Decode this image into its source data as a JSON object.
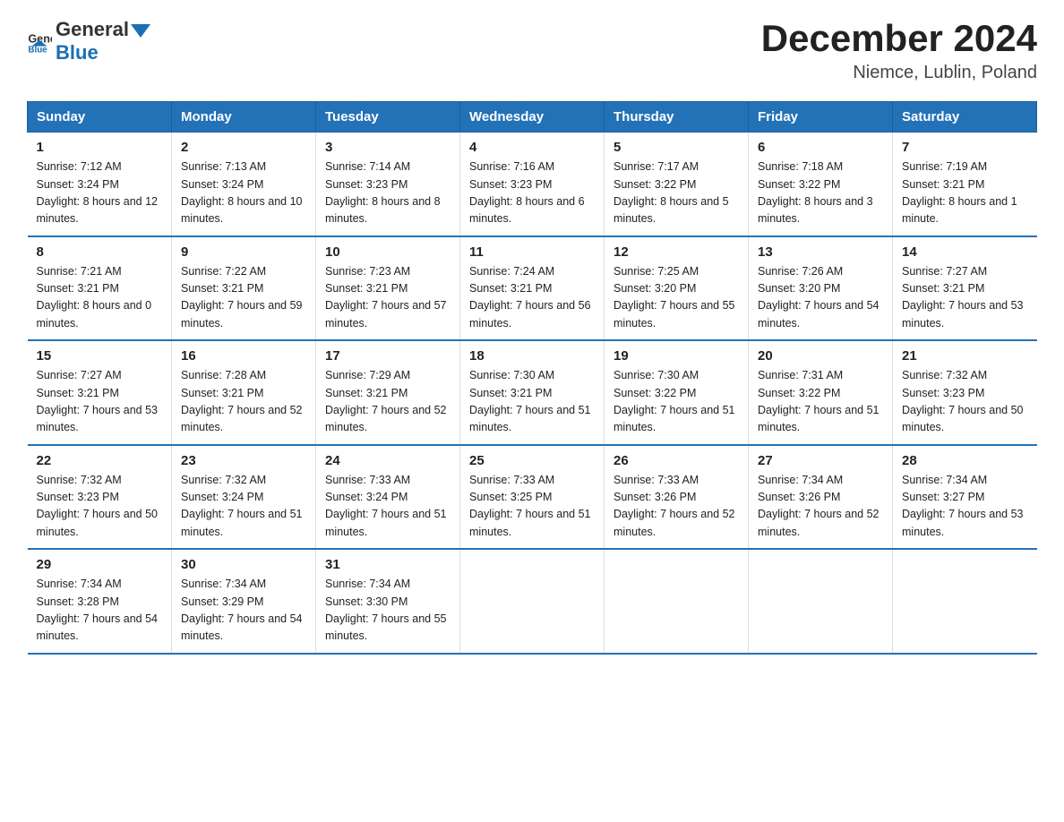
{
  "header": {
    "logo_general": "General",
    "logo_blue": "Blue",
    "month_year": "December 2024",
    "location": "Niemce, Lublin, Poland"
  },
  "days_of_week": [
    "Sunday",
    "Monday",
    "Tuesday",
    "Wednesday",
    "Thursday",
    "Friday",
    "Saturday"
  ],
  "weeks": [
    [
      {
        "num": "1",
        "sunrise": "Sunrise: 7:12 AM",
        "sunset": "Sunset: 3:24 PM",
        "daylight": "Daylight: 8 hours and 12 minutes."
      },
      {
        "num": "2",
        "sunrise": "Sunrise: 7:13 AM",
        "sunset": "Sunset: 3:24 PM",
        "daylight": "Daylight: 8 hours and 10 minutes."
      },
      {
        "num": "3",
        "sunrise": "Sunrise: 7:14 AM",
        "sunset": "Sunset: 3:23 PM",
        "daylight": "Daylight: 8 hours and 8 minutes."
      },
      {
        "num": "4",
        "sunrise": "Sunrise: 7:16 AM",
        "sunset": "Sunset: 3:23 PM",
        "daylight": "Daylight: 8 hours and 6 minutes."
      },
      {
        "num": "5",
        "sunrise": "Sunrise: 7:17 AM",
        "sunset": "Sunset: 3:22 PM",
        "daylight": "Daylight: 8 hours and 5 minutes."
      },
      {
        "num": "6",
        "sunrise": "Sunrise: 7:18 AM",
        "sunset": "Sunset: 3:22 PM",
        "daylight": "Daylight: 8 hours and 3 minutes."
      },
      {
        "num": "7",
        "sunrise": "Sunrise: 7:19 AM",
        "sunset": "Sunset: 3:21 PM",
        "daylight": "Daylight: 8 hours and 1 minute."
      }
    ],
    [
      {
        "num": "8",
        "sunrise": "Sunrise: 7:21 AM",
        "sunset": "Sunset: 3:21 PM",
        "daylight": "Daylight: 8 hours and 0 minutes."
      },
      {
        "num": "9",
        "sunrise": "Sunrise: 7:22 AM",
        "sunset": "Sunset: 3:21 PM",
        "daylight": "Daylight: 7 hours and 59 minutes."
      },
      {
        "num": "10",
        "sunrise": "Sunrise: 7:23 AM",
        "sunset": "Sunset: 3:21 PM",
        "daylight": "Daylight: 7 hours and 57 minutes."
      },
      {
        "num": "11",
        "sunrise": "Sunrise: 7:24 AM",
        "sunset": "Sunset: 3:21 PM",
        "daylight": "Daylight: 7 hours and 56 minutes."
      },
      {
        "num": "12",
        "sunrise": "Sunrise: 7:25 AM",
        "sunset": "Sunset: 3:20 PM",
        "daylight": "Daylight: 7 hours and 55 minutes."
      },
      {
        "num": "13",
        "sunrise": "Sunrise: 7:26 AM",
        "sunset": "Sunset: 3:20 PM",
        "daylight": "Daylight: 7 hours and 54 minutes."
      },
      {
        "num": "14",
        "sunrise": "Sunrise: 7:27 AM",
        "sunset": "Sunset: 3:21 PM",
        "daylight": "Daylight: 7 hours and 53 minutes."
      }
    ],
    [
      {
        "num": "15",
        "sunrise": "Sunrise: 7:27 AM",
        "sunset": "Sunset: 3:21 PM",
        "daylight": "Daylight: 7 hours and 53 minutes."
      },
      {
        "num": "16",
        "sunrise": "Sunrise: 7:28 AM",
        "sunset": "Sunset: 3:21 PM",
        "daylight": "Daylight: 7 hours and 52 minutes."
      },
      {
        "num": "17",
        "sunrise": "Sunrise: 7:29 AM",
        "sunset": "Sunset: 3:21 PM",
        "daylight": "Daylight: 7 hours and 52 minutes."
      },
      {
        "num": "18",
        "sunrise": "Sunrise: 7:30 AM",
        "sunset": "Sunset: 3:21 PM",
        "daylight": "Daylight: 7 hours and 51 minutes."
      },
      {
        "num": "19",
        "sunrise": "Sunrise: 7:30 AM",
        "sunset": "Sunset: 3:22 PM",
        "daylight": "Daylight: 7 hours and 51 minutes."
      },
      {
        "num": "20",
        "sunrise": "Sunrise: 7:31 AM",
        "sunset": "Sunset: 3:22 PM",
        "daylight": "Daylight: 7 hours and 51 minutes."
      },
      {
        "num": "21",
        "sunrise": "Sunrise: 7:32 AM",
        "sunset": "Sunset: 3:23 PM",
        "daylight": "Daylight: 7 hours and 50 minutes."
      }
    ],
    [
      {
        "num": "22",
        "sunrise": "Sunrise: 7:32 AM",
        "sunset": "Sunset: 3:23 PM",
        "daylight": "Daylight: 7 hours and 50 minutes."
      },
      {
        "num": "23",
        "sunrise": "Sunrise: 7:32 AM",
        "sunset": "Sunset: 3:24 PM",
        "daylight": "Daylight: 7 hours and 51 minutes."
      },
      {
        "num": "24",
        "sunrise": "Sunrise: 7:33 AM",
        "sunset": "Sunset: 3:24 PM",
        "daylight": "Daylight: 7 hours and 51 minutes."
      },
      {
        "num": "25",
        "sunrise": "Sunrise: 7:33 AM",
        "sunset": "Sunset: 3:25 PM",
        "daylight": "Daylight: 7 hours and 51 minutes."
      },
      {
        "num": "26",
        "sunrise": "Sunrise: 7:33 AM",
        "sunset": "Sunset: 3:26 PM",
        "daylight": "Daylight: 7 hours and 52 minutes."
      },
      {
        "num": "27",
        "sunrise": "Sunrise: 7:34 AM",
        "sunset": "Sunset: 3:26 PM",
        "daylight": "Daylight: 7 hours and 52 minutes."
      },
      {
        "num": "28",
        "sunrise": "Sunrise: 7:34 AM",
        "sunset": "Sunset: 3:27 PM",
        "daylight": "Daylight: 7 hours and 53 minutes."
      }
    ],
    [
      {
        "num": "29",
        "sunrise": "Sunrise: 7:34 AM",
        "sunset": "Sunset: 3:28 PM",
        "daylight": "Daylight: 7 hours and 54 minutes."
      },
      {
        "num": "30",
        "sunrise": "Sunrise: 7:34 AM",
        "sunset": "Sunset: 3:29 PM",
        "daylight": "Daylight: 7 hours and 54 minutes."
      },
      {
        "num": "31",
        "sunrise": "Sunrise: 7:34 AM",
        "sunset": "Sunset: 3:30 PM",
        "daylight": "Daylight: 7 hours and 55 minutes."
      },
      null,
      null,
      null,
      null
    ]
  ]
}
